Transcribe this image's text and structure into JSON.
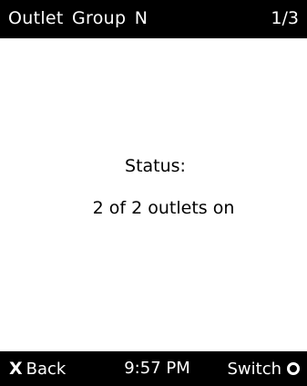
{
  "header": {
    "title": "Outlet Group N",
    "page_indicator": "1/3"
  },
  "main": {
    "status_label": "Status:",
    "status_value": "2 of 2 outlets on"
  },
  "footer": {
    "back_icon": "x-icon",
    "back_label": "Back",
    "time": "9:57 PM",
    "switch_label": "Switch",
    "switch_icon": "circle-icon"
  },
  "colors": {
    "bar_background": "#000000",
    "bar_text": "#ffffff",
    "body_background": "#ffffff",
    "body_text": "#000000"
  }
}
